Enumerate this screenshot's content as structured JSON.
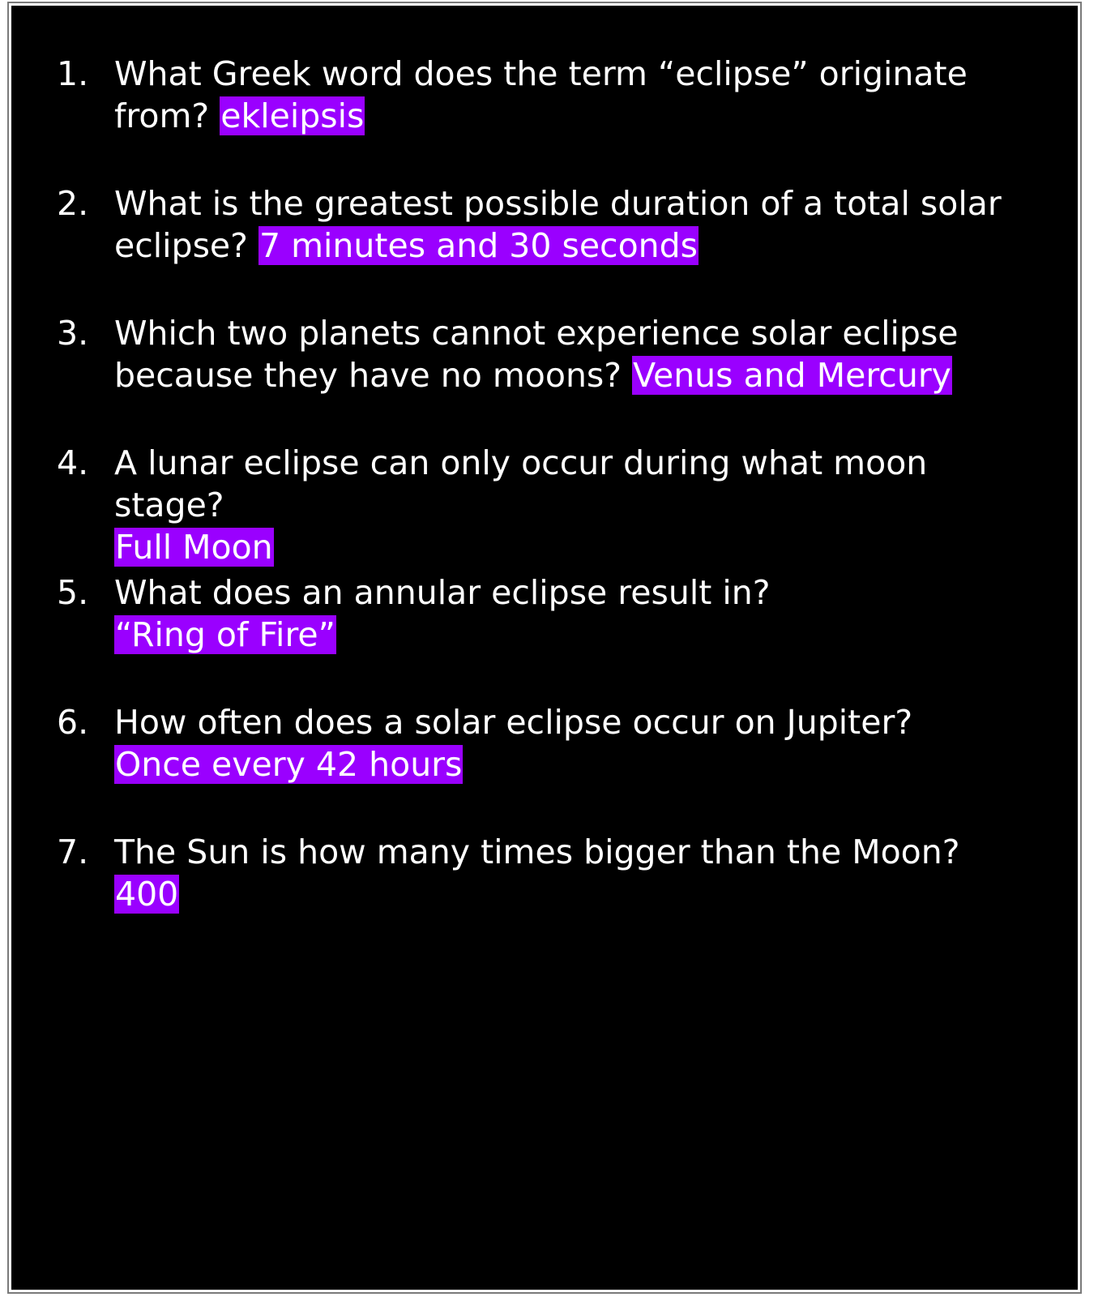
{
  "colors": {
    "background": "#000000",
    "border": "#ffffff",
    "text": "#ffffff",
    "answer_highlight": "#9a00ff"
  },
  "items": [
    {
      "number": "1.",
      "question": "What Greek word does the term “eclipse” originate from?",
      "answer": "ekleipsis"
    },
    {
      "number": "2.",
      "question": "What is the greatest possible duration of a total solar eclipse?",
      "answer": "7 minutes and 30 seconds"
    },
    {
      "number": "3.",
      "question": "Which two planets cannot experience solar eclipse because they have no moons?",
      "answer": "Venus and Mercury"
    },
    {
      "number": "4.",
      "question": "A lunar eclipse can only occur during what moon stage?",
      "answer": "Full Moon"
    },
    {
      "number": "5.",
      "question": "What does an annular eclipse result in?",
      "answer": "“Ring of Fire”"
    },
    {
      "number": "6.",
      "question": "How often does a solar eclipse occur on Jupiter?",
      "answer": "Once every 42 hours"
    },
    {
      "number": "7.",
      "question": "The Sun is how many times bigger than the Moon?",
      "answer": "400"
    }
  ]
}
